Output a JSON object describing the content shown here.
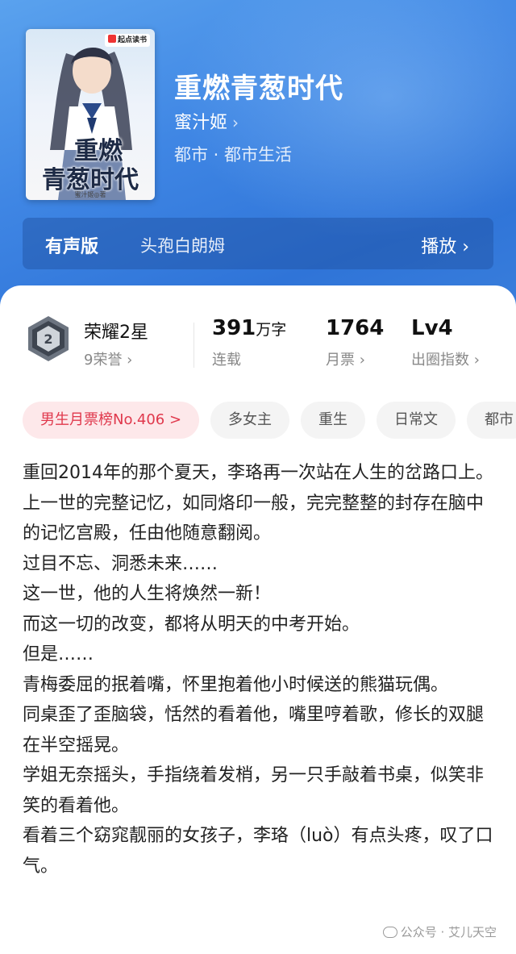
{
  "book": {
    "title": "重燃青葱时代",
    "author": "蜜汁姬",
    "genre": "都市 · 都市生活",
    "cover": {
      "badge": "起点读书",
      "title_line1": "重燃",
      "title_line2": "青葱时代",
      "author": "蜜汁姬◎著"
    }
  },
  "audio": {
    "label": "有声版",
    "narrator": "头孢白朗姆",
    "play": "播放 ›"
  },
  "honor": {
    "title": "荣耀2星",
    "sub": "9荣誉 ›",
    "level": "2"
  },
  "stats": [
    {
      "value": "391",
      "unit": "万字",
      "label": "连载"
    },
    {
      "value": "1764",
      "unit": "",
      "label": "月票 ›"
    },
    {
      "value": "Lv4",
      "unit": "",
      "label": "出圈指数 ›"
    }
  ],
  "tags": [
    "男生月票榜No.406 >",
    "多女主",
    "重生",
    "日常文",
    "都市"
  ],
  "synopsis": [
    "重回2014年的那个夏天，李珞再一次站在人生的岔路口上。",
    "上一世的完整记忆，如同烙印一般，完完整整的封存在脑中的记忆宫殿，任由他随意翻阅。",
    "过目不忘、洞悉未来……",
    "这一世，他的人生将焕然一新！",
    "而这一切的改变，都将从明天的中考开始。",
    "但是……",
    "青梅委屈的抿着嘴，怀里抱着他小时候送的熊猫玩偶。",
    "同桌歪了歪脑袋，恬然的看着他，嘴里哼着歌，修长的双腿在半空摇晃。",
    "学姐无奈摇头，手指绕着发梢，另一只手敲着书桌，似笑非笑的看着他。",
    "看着三个窈窕靓丽的女孩子，李珞（luò）有点头疼，叹了口气。"
  ],
  "watermark": "公众号 · 艾儿天空",
  "colors": {
    "hero": "#3f86e4",
    "tag_hot_text": "#e0384c",
    "tag_hot_bg": "#fde8ea"
  }
}
